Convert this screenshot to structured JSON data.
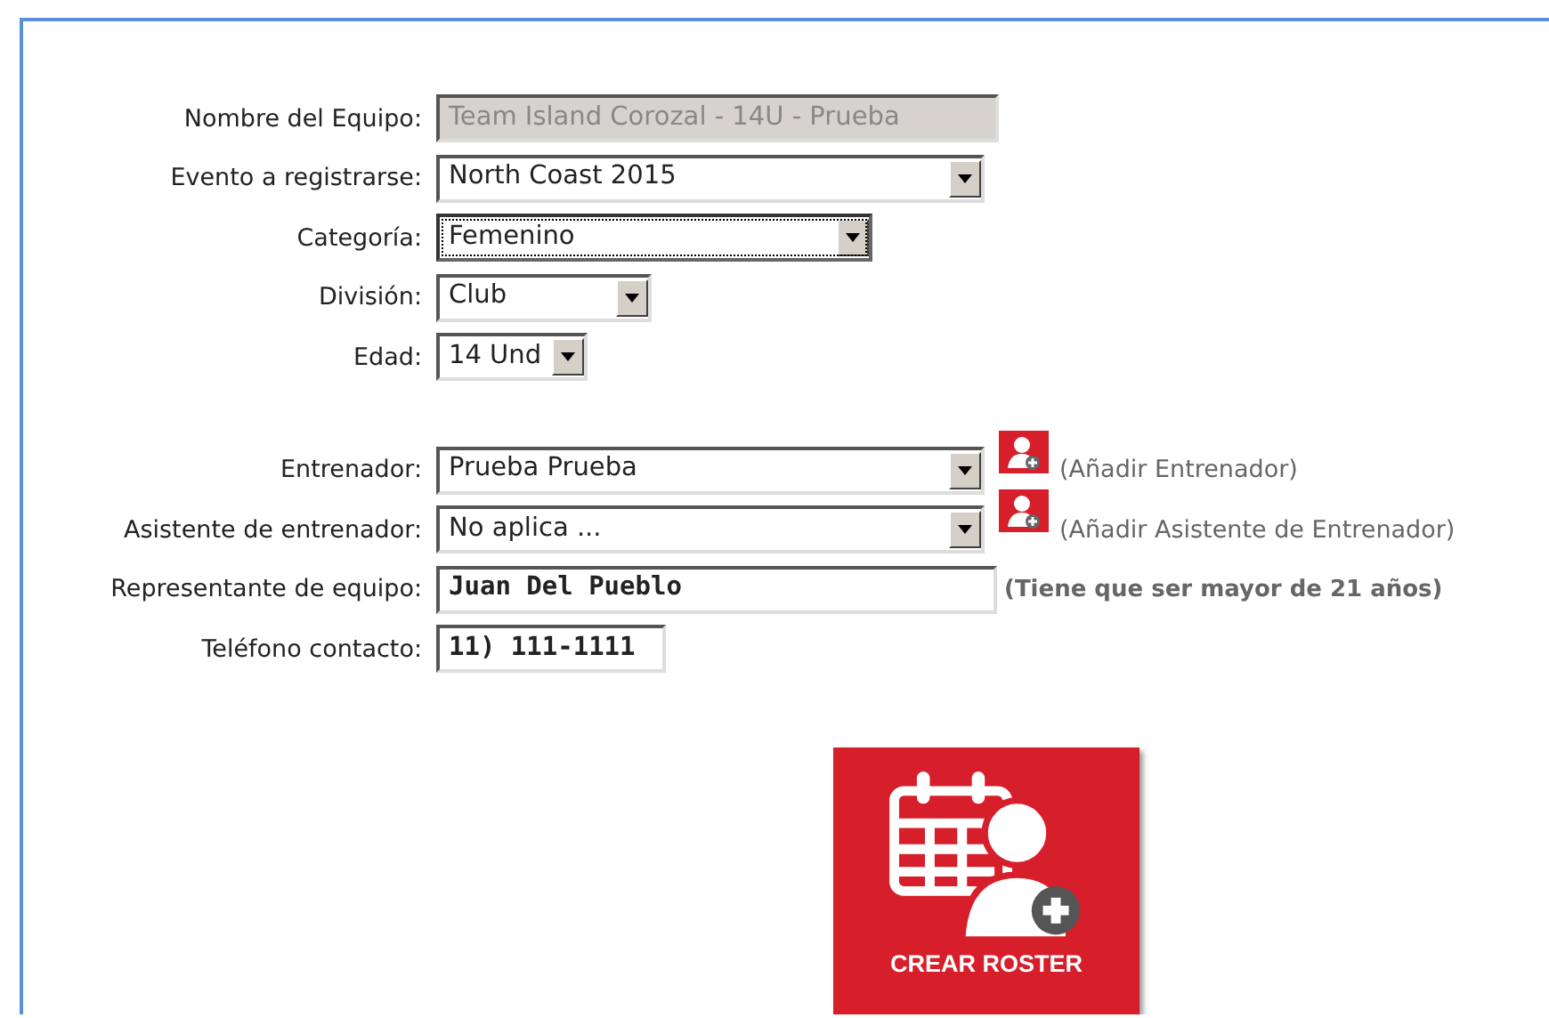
{
  "fields": [
    {
      "label": "Nombre del Equipo:",
      "kind": "text",
      "value": "Team Island Corozal - 14U - Prueba",
      "disabled": true,
      "focused": false
    },
    {
      "label": "Evento a registrarse:",
      "kind": "select",
      "value": "North Coast 2015",
      "disabled": false,
      "focused": false
    },
    {
      "label": "Categoría:",
      "kind": "select",
      "value": "Femenino",
      "disabled": false,
      "focused": true
    },
    {
      "label": "División:",
      "kind": "select",
      "value": "Club",
      "disabled": false,
      "focused": false
    },
    {
      "label": "Edad:",
      "kind": "select",
      "value": "14 Und",
      "disabled": false,
      "focused": false
    }
  ],
  "staff": [
    {
      "label": "Entrenador:",
      "kind": "select",
      "value": "Prueba Prueba",
      "add_link": "(Añadir Entrenador)"
    },
    {
      "label": "Asistente de entrenador:",
      "kind": "select",
      "value": "No aplica ...",
      "add_link": "(Añadir Asistente de Entrenador)"
    },
    {
      "label": "Representante de equipo:",
      "kind": "text",
      "value": "Juan Del Pueblo",
      "note": "(Tiene que ser mayor de 21 años)"
    },
    {
      "label": "Teléfono contacto:",
      "kind": "text",
      "value": "11) 111-1111"
    }
  ],
  "create_button": {
    "label": "CREAR ROSTER"
  }
}
